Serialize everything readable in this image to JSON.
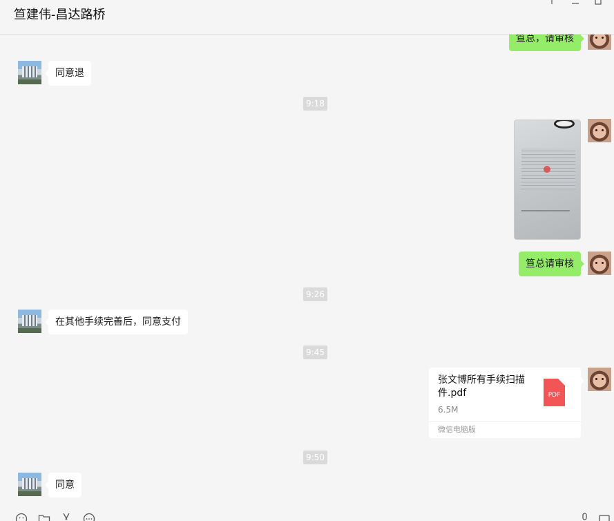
{
  "window": {
    "title": "笪建伟-昌达路桥"
  },
  "messages": {
    "m1": "笪总，请审核",
    "m2": "同意退",
    "t1": "9:18",
    "m3": "笪总请审核",
    "t2": "9:26",
    "m4": "在其他手续完善后，同意支付",
    "t3": "9:45",
    "t4": "9:50",
    "m5": "同意"
  },
  "file": {
    "name": "张文博所有手续扫描件.pdf",
    "size": "6.5M",
    "source": "微信电脑版",
    "badge": "PDF"
  },
  "icons": {
    "toolbar_left": [
      "emoji-icon",
      "folder-icon",
      "scissors-icon",
      "chat-history-icon"
    ],
    "toolbar_right": [
      "microphone-icon",
      "video-call-icon"
    ],
    "file_type": "pdf-icon"
  },
  "colors": {
    "sent_bubble": "#95ec69",
    "received_bubble": "#ffffff",
    "pdf": "#f15555",
    "background": "#f5f5f5"
  }
}
